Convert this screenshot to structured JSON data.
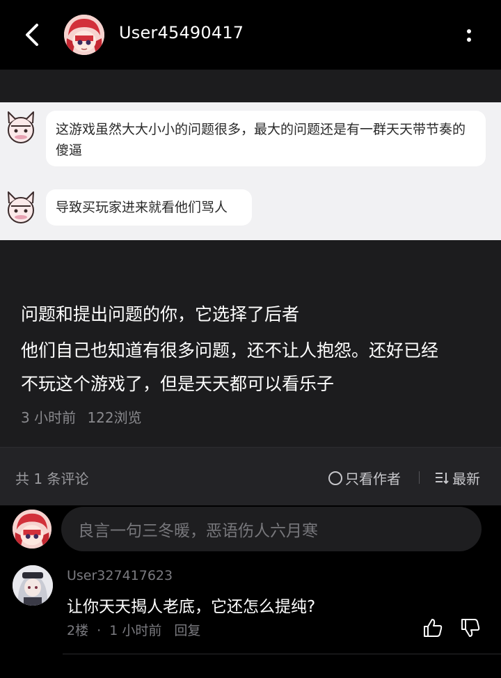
{
  "header": {
    "username": "User45490417"
  },
  "embedded_chat": {
    "messages": [
      {
        "text": "这游戏虽然大大小小的问题很多，最大的问题还是有一群天天带节奏的傻逼"
      },
      {
        "text": "导致买玩家进来就看他们骂人"
      }
    ]
  },
  "post": {
    "lines": [
      "问题和提出问题的你，它选择了后者",
      "他们自己也知道有很多问题，还不让人抱怨。还好已经",
      "不玩这个游戏了，但是天天都可以看乐子"
    ],
    "time": "3 小时前",
    "views": "122浏览"
  },
  "comment_bar": {
    "count_label": "共 1 条评论",
    "author_only_label": "只看作者",
    "sort_label": "最新"
  },
  "composer": {
    "placeholder": "良言一句三冬暖，恶语伤人六月寒"
  },
  "comments": [
    {
      "username": "User327417623",
      "text": "让你天天揭人老底，它还怎么提纯?",
      "floor": "2楼",
      "separator": "·",
      "time": "1 小时前",
      "reply_label": "回复"
    }
  ],
  "colors": {
    "header_bg": "#000000",
    "page_bg": "#1c1c1e",
    "embed_bg": "#f1f1f3",
    "muted_text": "#8a8a8e"
  }
}
